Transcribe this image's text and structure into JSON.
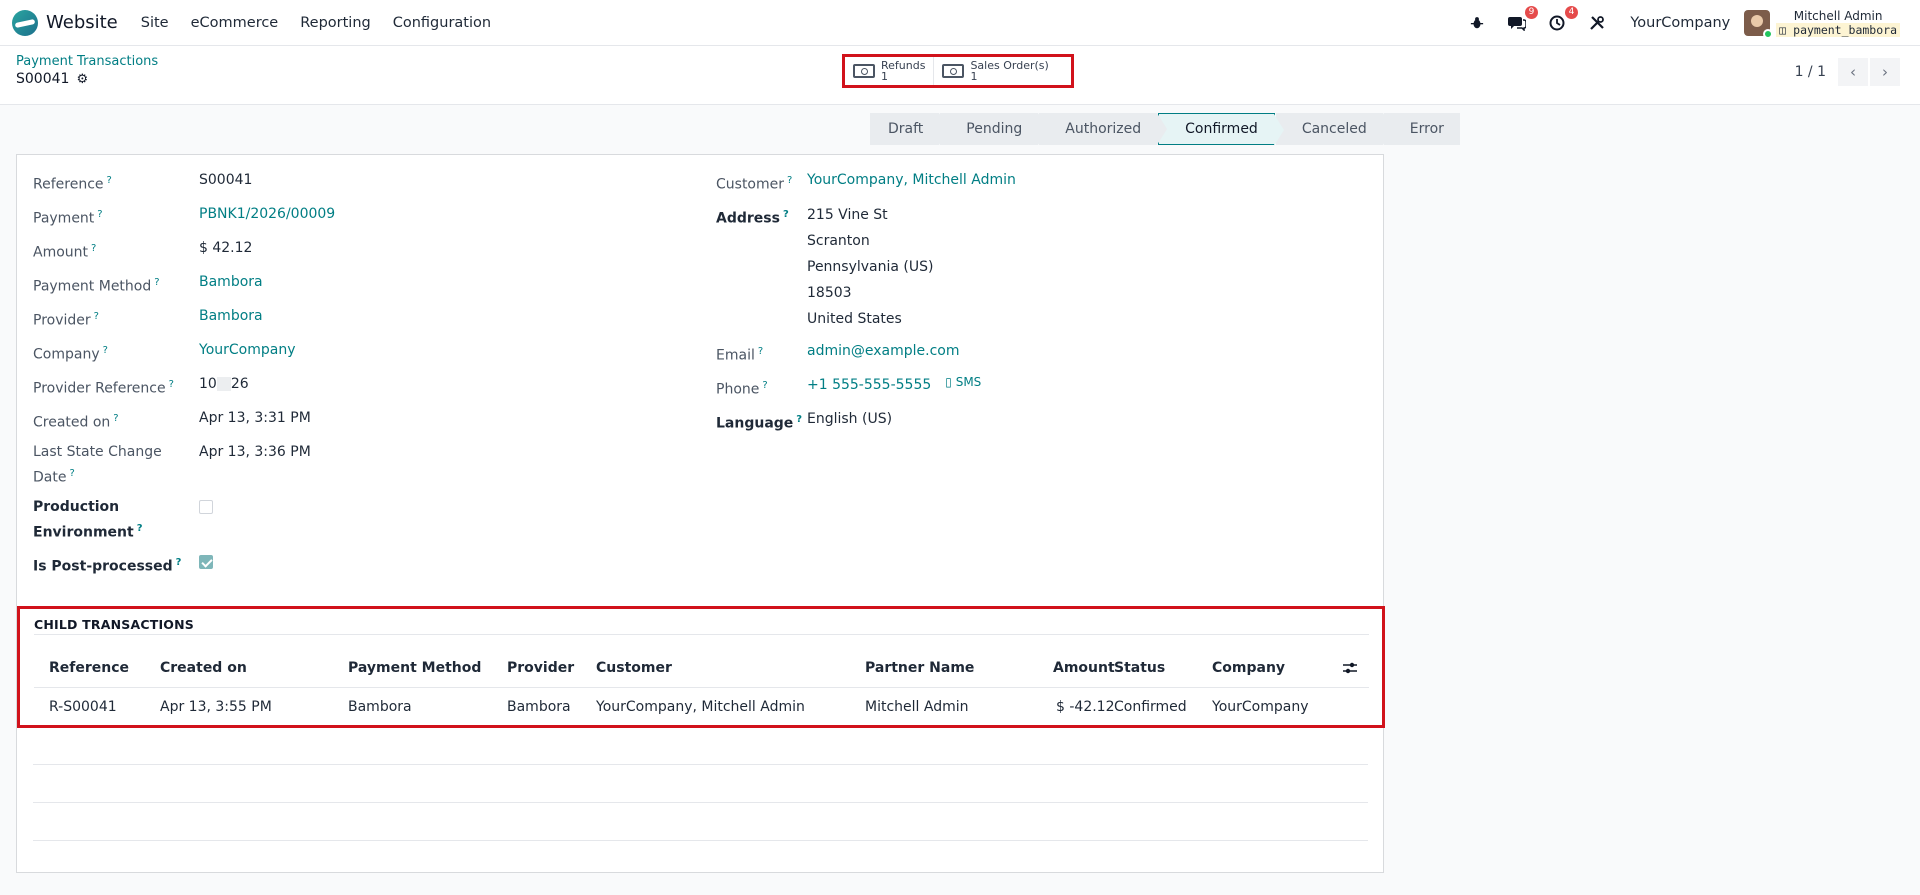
{
  "topbar": {
    "app_name": "Website",
    "menu": [
      "Site",
      "eCommerce",
      "Reporting",
      "Configuration"
    ],
    "messages_badge": "9",
    "activities_badge": "4",
    "company": "YourCompany",
    "user_name": "Mitchell Admin",
    "db_name": "payment_bambora"
  },
  "breadcrumb": {
    "parent": "Payment Transactions",
    "current": "S00041"
  },
  "smart_buttons": [
    {
      "label": "Refunds",
      "count": "1"
    },
    {
      "label": "Sales Order(s)",
      "count": "1"
    }
  ],
  "pager": {
    "value": "1 / 1"
  },
  "statusbar": {
    "stages": [
      "Draft",
      "Pending",
      "Authorized",
      "Confirmed",
      "Canceled",
      "Error"
    ],
    "active": "Confirmed"
  },
  "left_fields": {
    "reference": {
      "label": "Reference",
      "value": "S00041"
    },
    "payment": {
      "label": "Payment",
      "value": "PBNK1/2026/00009"
    },
    "amount": {
      "label": "Amount",
      "value": "$ 42.12"
    },
    "payment_method": {
      "label": "Payment Method",
      "value": "Bambora"
    },
    "provider": {
      "label": "Provider",
      "value": "Bambora"
    },
    "company": {
      "label": "Company",
      "value": "YourCompany"
    },
    "provider_reference": {
      "label": "Provider Reference",
      "value_start": "10",
      "value_end": "26"
    },
    "created_on": {
      "label": "Created on",
      "value": "Apr 13, 3:31 PM"
    },
    "last_state_change_line1": "Last State Change",
    "last_state_change_line2": "Date",
    "last_state_change_value": "Apr 13, 3:36 PM",
    "production_env_line1": "Production",
    "production_env_line2": "Environment",
    "is_post_processed": "Is Post-processed"
  },
  "right_fields": {
    "customer": {
      "label": "Customer",
      "value": "YourCompany, Mitchell Admin"
    },
    "address": {
      "label": "Address",
      "lines": [
        "215 Vine St",
        "Scranton",
        "Pennsylvania (US)",
        "18503",
        "United States"
      ]
    },
    "email": {
      "label": "Email",
      "value": "admin@example.com"
    },
    "phone": {
      "label": "Phone",
      "value": "+1 555-555-5555",
      "sms": "SMS"
    },
    "language": {
      "label": "Language",
      "value": "English (US)"
    }
  },
  "child_transactions": {
    "title": "CHILD TRANSACTIONS",
    "columns": [
      "Reference",
      "Created on",
      "Payment Method",
      "Provider",
      "Customer",
      "Partner Name",
      "Amount",
      "Status",
      "Company"
    ],
    "rows": [
      [
        "R-S00041",
        "Apr 13, 3:55 PM",
        "Bambora",
        "Bambora",
        "YourCompany, Mitchell Admin",
        "Mitchell Admin",
        "$ -42.12",
        "Confirmed",
        "YourCompany"
      ]
    ]
  }
}
